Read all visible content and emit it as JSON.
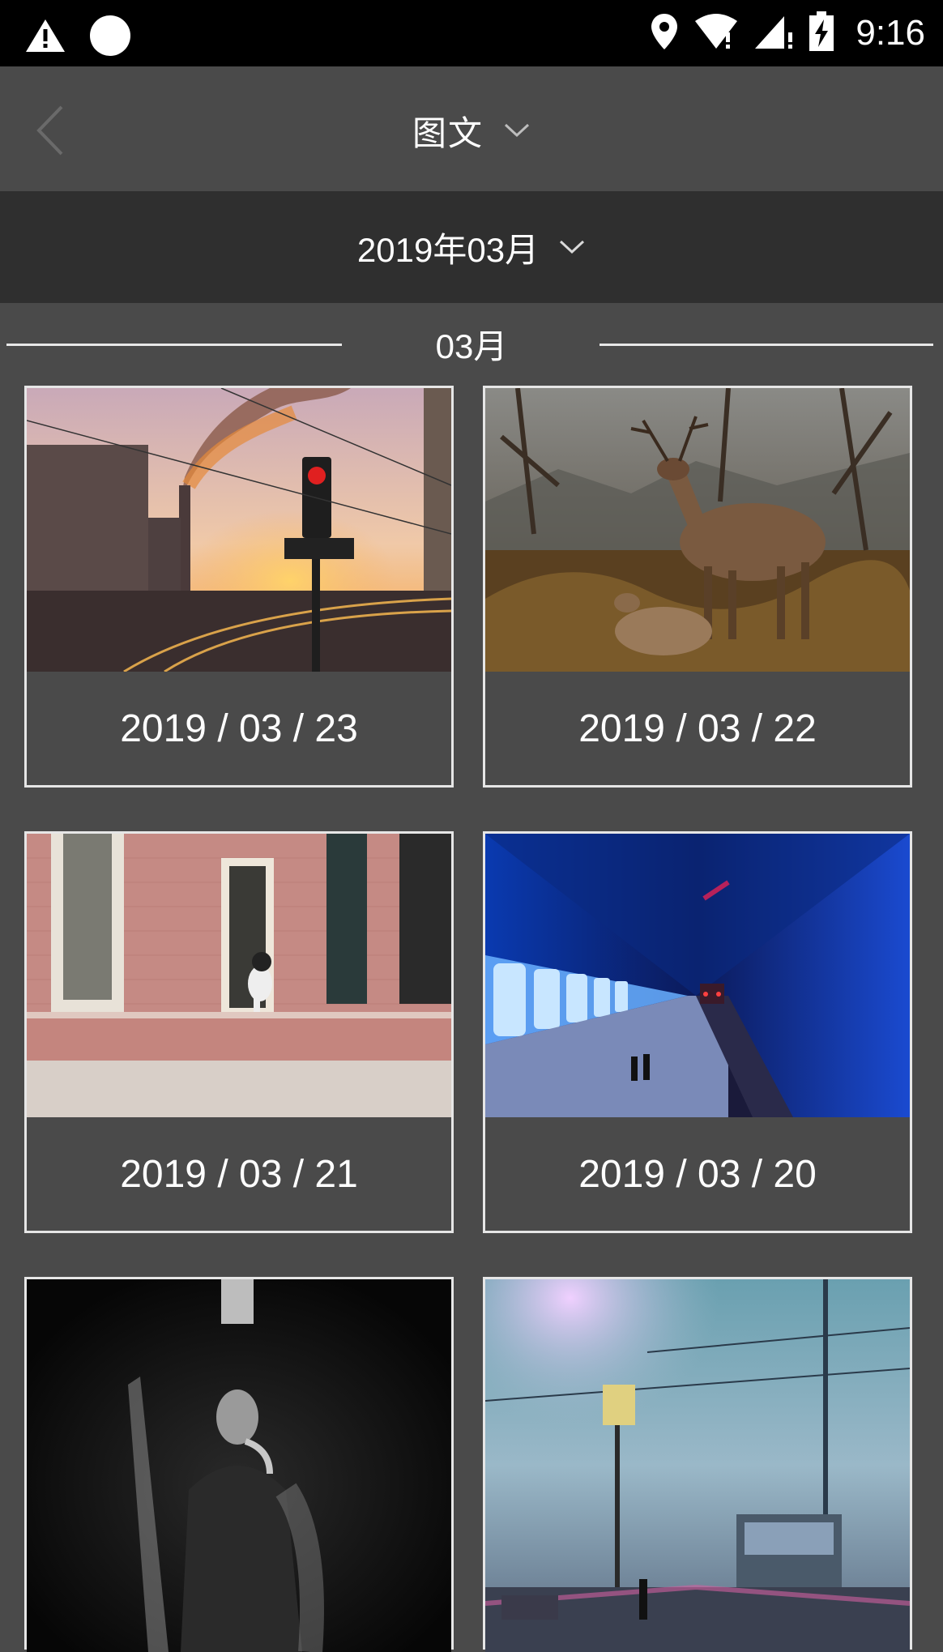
{
  "status_bar": {
    "time": "9:16",
    "icons": [
      "warning-icon",
      "circle-icon",
      "location-icon",
      "wifi-icon",
      "signal-icon",
      "battery-charging-icon"
    ]
  },
  "header": {
    "title": "图文",
    "back_icon": "chevron-left-icon",
    "dropdown_icon": "chevron-down-icon"
  },
  "month_selector": {
    "label": "2019年03月",
    "dropdown_icon": "chevron-down-icon"
  },
  "section": {
    "title": "03月"
  },
  "cards": [
    {
      "date": "2019 / 03 / 23",
      "image": "city-sunset-traffic-light"
    },
    {
      "date": "2019 / 03 / 22",
      "image": "deer-in-forest"
    },
    {
      "date": "2019 / 03 / 21",
      "image": "dog-in-pink-window"
    },
    {
      "date": "2019 / 03 / 20",
      "image": "blue-subway-station"
    },
    {
      "date": "",
      "image": "man-smoking-dark"
    },
    {
      "date": "",
      "image": "foggy-tram-street"
    }
  ],
  "colors": {
    "background": "#4a4a4a",
    "month_bar": "#2f2f2f",
    "status_bar": "#000000",
    "border": "#e6e6e6"
  }
}
